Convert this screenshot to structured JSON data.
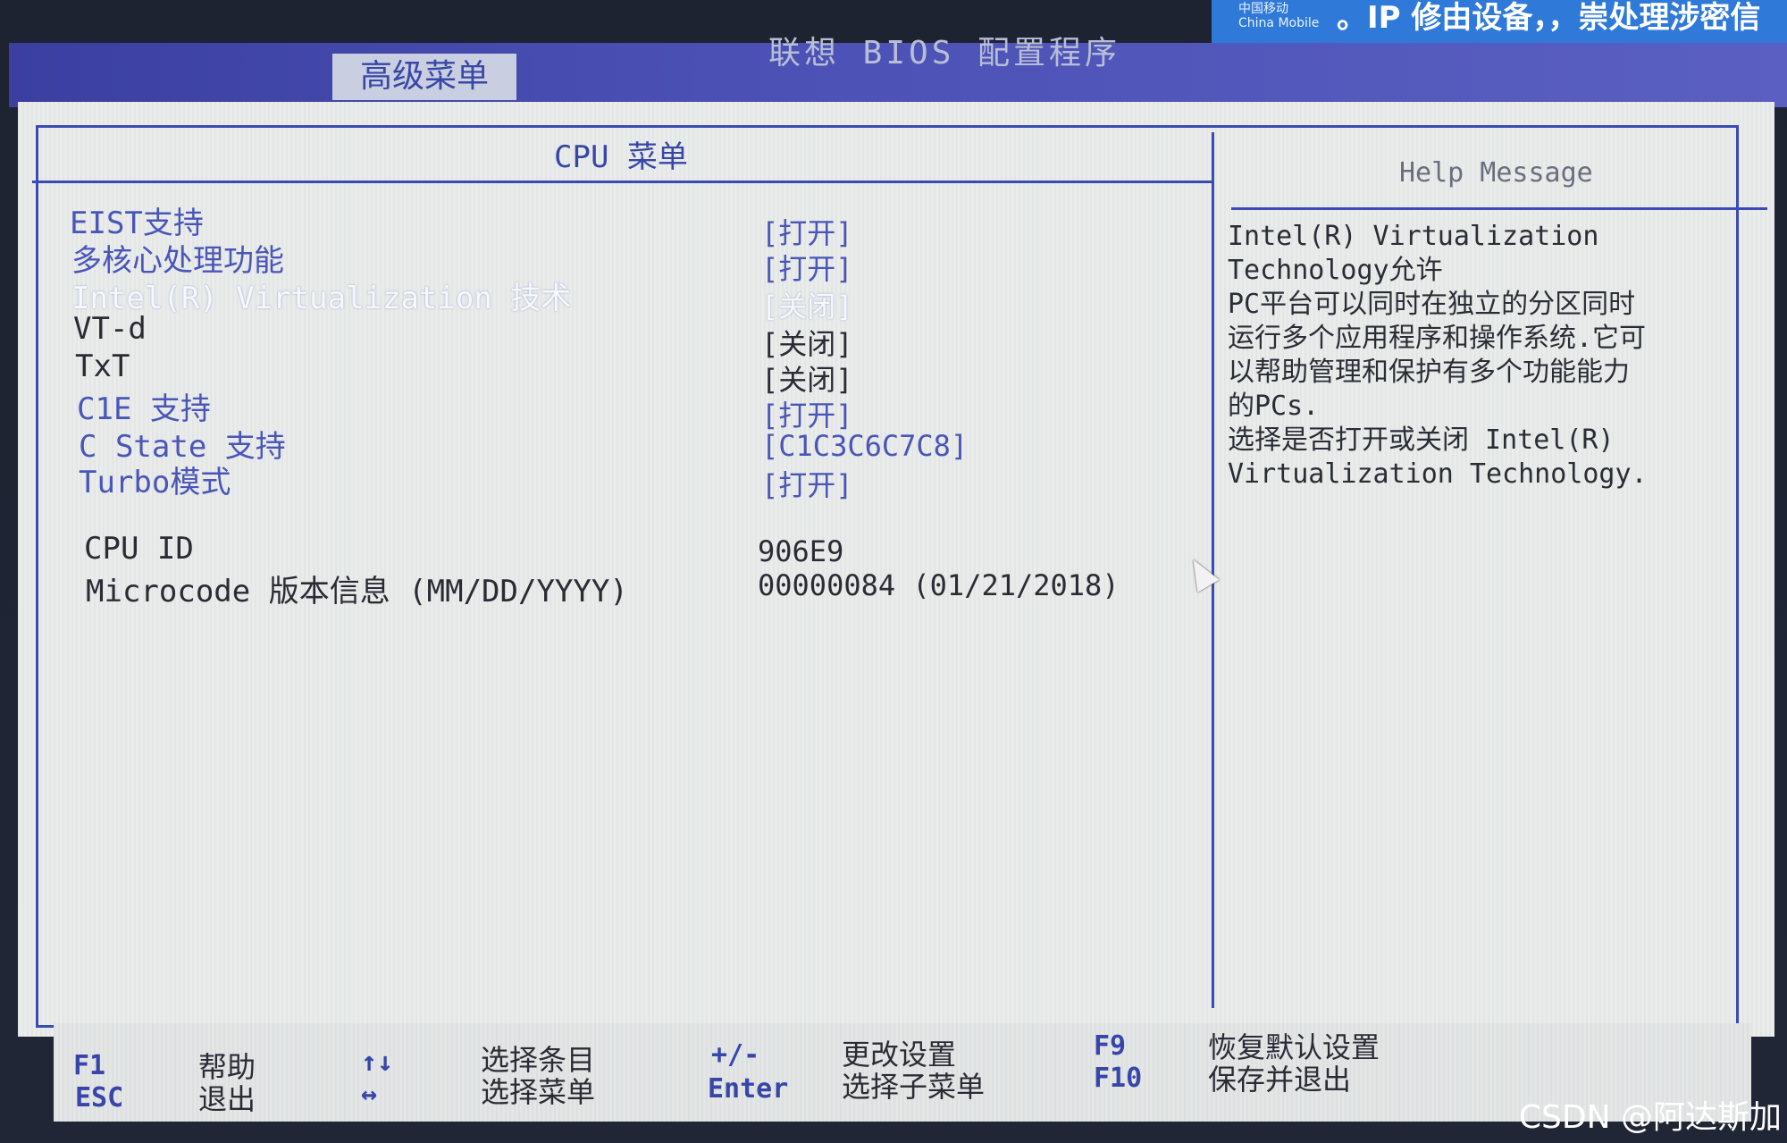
{
  "bios": {
    "title": "联想 BIOS 配置程序",
    "tab_active": "高级菜单"
  },
  "overlay": {
    "logo_line1": "中国移动",
    "logo_line2": "China Mobile",
    "text": "。IP 修由设备，，崇处理涉密信"
  },
  "menu": {
    "title": "CPU 菜单",
    "items": [
      {
        "label": "EIST支持",
        "value": "[打开]"
      },
      {
        "label": "多核心处理功能",
        "value": "[打开]"
      },
      {
        "label": "Intel(R) Virtualization 技术",
        "value": "[关闭]"
      },
      {
        "label": "VT-d",
        "value": "[关闭]"
      },
      {
        "label": "TxT",
        "value": "[关闭]"
      },
      {
        "label": "C1E 支持",
        "value": "[打开]"
      },
      {
        "label": "C State 支持",
        "value": "[C1C3C6C7C8]"
      },
      {
        "label": "Turbo模式",
        "value": "[打开]"
      }
    ],
    "info": [
      {
        "label": "CPU ID",
        "value": "906E9"
      },
      {
        "label": "Microcode 版本信息 (MM/DD/YYYY)",
        "value": "00000084 (01/21/2018)"
      }
    ]
  },
  "help": {
    "title": "Help Message",
    "lines": [
      "Intel(R) Virtualization",
      "Technology允许",
      "PC平台可以同时在独立的分区同时",
      "运行多个应用程序和操作系统.它可",
      "以帮助管理和保护有多个功能能力",
      "的PCs.",
      "选择是否打开或关闭  Intel(R)",
      "Virtualization Technology."
    ]
  },
  "footer": {
    "f1": "F1",
    "f1_desc": "帮助",
    "esc": "ESC",
    "esc_desc": "退出",
    "updown": "↑↓",
    "updown_desc": "选择条目",
    "leftright": "↔",
    "leftright_desc": "选择菜单",
    "plusminus": "+/-",
    "plusminus_desc": "更改设置",
    "enter": "Enter",
    "enter_desc": "选择子菜单",
    "f9": "F9",
    "f9_desc": "恢复默认设置",
    "f10": "F10",
    "f10_desc": "保存并退出"
  },
  "watermark": "CSDN @阿达斯加",
  "colors": {
    "frame": "#3b4bb3",
    "blue_text": "#4a55b8",
    "panel_bg": "#e9ecea",
    "topbar": "#4b50b5"
  }
}
